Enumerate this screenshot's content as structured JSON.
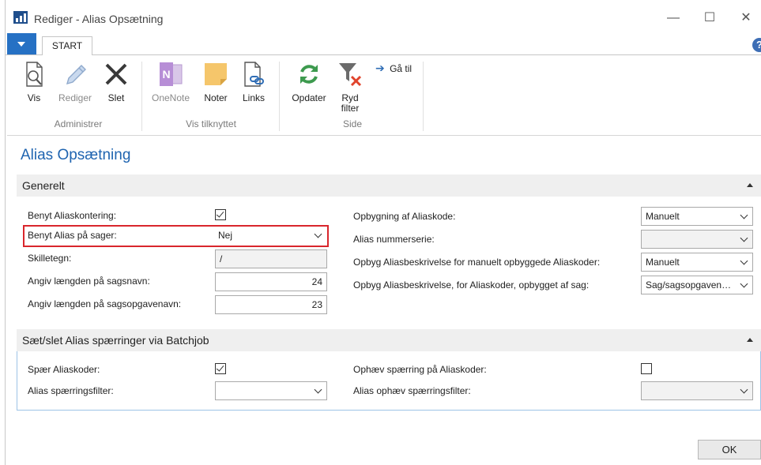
{
  "window": {
    "title": "Rediger - Alias Opsætning",
    "minimize": "—",
    "maximize": "☐",
    "close": "✕"
  },
  "ribbon": {
    "start_tab": "START",
    "help": "?",
    "buttons": [
      {
        "label": "Vis",
        "icon": "view-icon"
      },
      {
        "label": "Rediger",
        "icon": "edit-pencil-icon"
      },
      {
        "label": "Slet",
        "icon": "delete-x-icon"
      },
      {
        "label": "OneNote",
        "icon": "onenote-icon"
      },
      {
        "label": "Noter",
        "icon": "note-icon"
      },
      {
        "label": "Links",
        "icon": "links-icon"
      },
      {
        "label": "Opdater",
        "icon": "refresh-icon"
      },
      {
        "label": "Ryd filter",
        "icon": "clear-filter-icon"
      },
      {
        "label": "Gå til",
        "icon": "go-to-arrow-icon"
      }
    ],
    "groups": {
      "administrer": "Administrer",
      "vis_tilknyttet": "Vis tilknyttet",
      "side": "Side"
    }
  },
  "page_title": "Alias Opsætning",
  "generelt": {
    "header": "Generelt",
    "benyt_aliaskontering": {
      "label": "Benyt Aliaskontering:",
      "checked": true
    },
    "benyt_alias_paa_sager": {
      "label": "Benyt Alias på sager:",
      "value": "Nej"
    },
    "skilletegn": {
      "label": "Skilletegn:",
      "value": "/"
    },
    "laengde_sagsnavn": {
      "label": "Angiv længden på sagsnavn:",
      "value": "24"
    },
    "laengde_sagsopgavenavn": {
      "label": "Angiv længden på sagsopgavenavn:",
      "value": "23"
    },
    "opbygning_aliaskode": {
      "label": "Opbygning af Aliaskode:",
      "value": "Manuelt"
    },
    "alias_nummerserie": {
      "label": "Alias nummerserie:",
      "value": ""
    },
    "opbyg_beskr_manuelt": {
      "label": "Opbyg Aliasbeskrivelse for manuelt opbyggede Aliaskoder:",
      "value": "Manuelt"
    },
    "opbyg_beskr_sag": {
      "label": "Opbyg Aliasbeskrivelse, for Aliaskoder, opbygget af sag:",
      "value": "Sag/sagsopgaven…"
    }
  },
  "batchjob": {
    "header": "Sæt/slet Alias spærringer via Batchjob",
    "spaer_aliaskoder": {
      "label": "Spær Aliaskoder:",
      "checked": true
    },
    "alias_spaerringsfilter": {
      "label": "Alias spærringsfilter:",
      "value": ""
    },
    "ophaev_spaerring": {
      "label": "Ophæv spærring på Aliaskoder:",
      "checked": false
    },
    "alias_ophaev_filter": {
      "label": "Alias ophæv spærringsfilter:",
      "value": ""
    }
  },
  "ok_label": "OK",
  "colors": {
    "accent": "#1f64b0",
    "file_tab": "#2671c4",
    "highlight": "#d9262c"
  }
}
